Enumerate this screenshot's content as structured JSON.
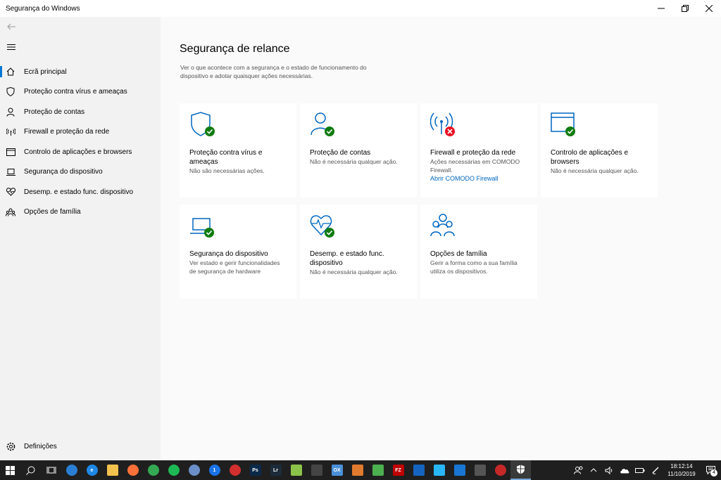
{
  "window": {
    "title": "Segurança do Windows"
  },
  "sidebar": {
    "items": [
      {
        "label": "Ecrã principal"
      },
      {
        "label": "Proteção contra vírus e ameaças"
      },
      {
        "label": "Proteção de contas"
      },
      {
        "label": "Firewall e proteção da rede"
      },
      {
        "label": "Controlo de aplicações e browsers"
      },
      {
        "label": "Segurança do dispositivo"
      },
      {
        "label": "Desemp. e estado func. dispositivo"
      },
      {
        "label": "Opções de família"
      }
    ],
    "settings_label": "Definições"
  },
  "main": {
    "title": "Segurança de relance",
    "description": "Ver o que acontece com a segurança e o estado de funcionamento do dispositivo e adotar quaisquer ações necessárias.",
    "cards": [
      {
        "title": "Proteção contra vírus e ameaças",
        "status": "Não são necessárias ações.",
        "state": "ok",
        "icon": "shield-icon"
      },
      {
        "title": "Proteção de contas",
        "status": "Não é necessária qualquer ação.",
        "state": "ok",
        "icon": "person-icon"
      },
      {
        "title": "Firewall e proteção da rede",
        "status": "Ações necessárias em COMODO Firewall.",
        "link": "Abrir COMODO Firewall",
        "state": "error",
        "icon": "antenna-icon"
      },
      {
        "title": "Controlo de aplicações e browsers",
        "status": "Não é necessária qualquer ação.",
        "state": "ok",
        "icon": "browser-window-icon"
      },
      {
        "title": "Segurança do dispositivo",
        "status": "Ver estado e gerir funcionalidades de segurança de hardware",
        "state": "ok",
        "icon": "laptop-icon"
      },
      {
        "title": "Desemp. e estado func. dispositivo",
        "status": "Não é necessária qualquer ação.",
        "state": "ok",
        "icon": "heart-pulse-icon"
      },
      {
        "title": "Opções de família",
        "status": "Gerir a forma como a sua família utiliza os dispositivos.",
        "state": "none",
        "icon": "family-icon"
      }
    ]
  },
  "taskbar": {
    "time": "18:12:14",
    "date": "11/10/2019",
    "notification_count": "4",
    "apps": [
      {
        "icon": "thunderbird-icon",
        "color": "#2a7fd4",
        "text": ""
      },
      {
        "icon": "edge-icon",
        "color": "#1e88e5",
        "text": "e"
      },
      {
        "icon": "file-explorer-icon",
        "color": "#f2c14e",
        "text": ""
      },
      {
        "icon": "firefox-icon",
        "color": "#ff7139",
        "text": ""
      },
      {
        "icon": "chrome-icon",
        "color": "#34a853",
        "text": ""
      },
      {
        "icon": "spotify-icon",
        "color": "#1db954",
        "text": ""
      },
      {
        "icon": "snowflake-app-icon",
        "color": "#6b8fc9",
        "text": ""
      },
      {
        "icon": "onepassword-icon",
        "color": "#1a73e8",
        "text": "1"
      },
      {
        "icon": "anydesk-icon",
        "color": "#d32f2f",
        "text": ""
      },
      {
        "icon": "photoshop-icon",
        "color": "#0b2a4a",
        "text": "Ps"
      },
      {
        "icon": "lightroom-icon",
        "color": "#1b2b3a",
        "text": "Lr"
      },
      {
        "icon": "pen-app-icon",
        "color": "#8bc34a",
        "text": ""
      },
      {
        "icon": "inkscape-icon",
        "color": "#444444",
        "text": ""
      },
      {
        "icon": "ox-app-icon",
        "color": "#4a90d9",
        "text": "OX"
      },
      {
        "icon": "grid-app-icon",
        "color": "#e07a2e",
        "text": ""
      },
      {
        "icon": "book-app-icon",
        "color": "#4caf50",
        "text": ""
      },
      {
        "icon": "filezilla-icon",
        "color": "#bf0000",
        "text": "FZ"
      },
      {
        "icon": "onedrive-box-icon",
        "color": "#1565c0",
        "text": ""
      },
      {
        "icon": "cloud-app-icon",
        "color": "#29b6f6",
        "text": ""
      },
      {
        "icon": "chart-app-icon",
        "color": "#1976d2",
        "text": ""
      },
      {
        "icon": "mail-app-icon",
        "color": "#555555",
        "text": ""
      },
      {
        "icon": "comodo-icon",
        "color": "#c62828",
        "text": ""
      }
    ]
  },
  "colors": {
    "accent": "#0078d7",
    "ok": "#107c10",
    "error": "#e81123",
    "icon_blue": "#0067c0"
  }
}
